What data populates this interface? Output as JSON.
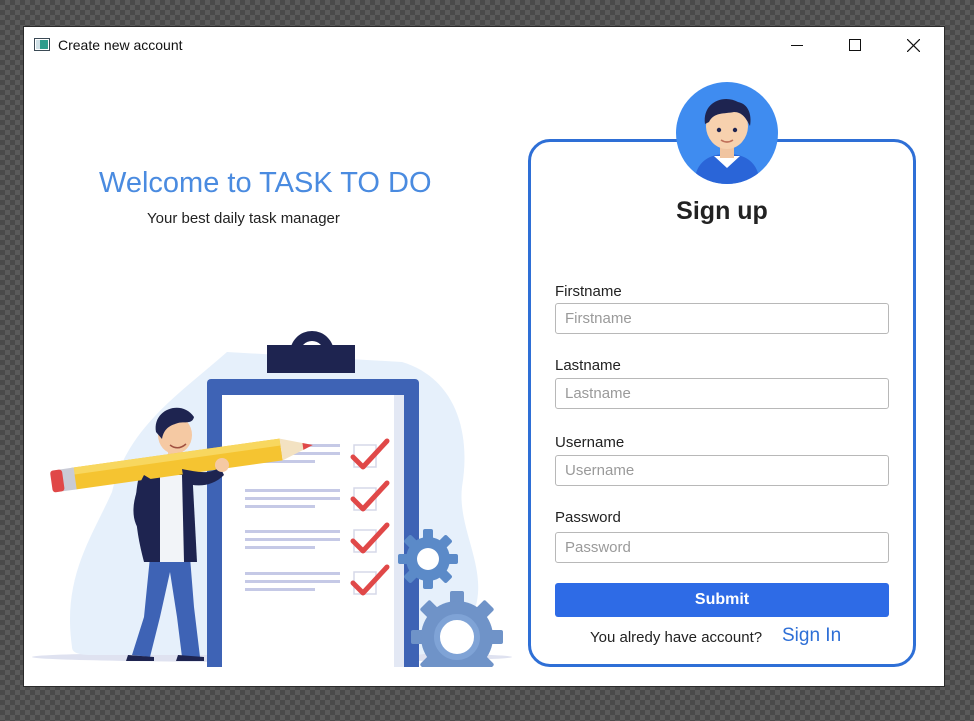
{
  "window": {
    "title": "Create new account",
    "controls": [
      "minimize-icon",
      "maximize-icon",
      "close-icon"
    ]
  },
  "hero": {
    "title": "Welcome to TASK TO DO",
    "subtitle": "Your best daily task manager",
    "illustration": "clipboard-checklist-illustration"
  },
  "form": {
    "title": "Sign up",
    "avatar_icon": "user-avatar-icon",
    "fields": [
      {
        "label": "Firstname",
        "placeholder": "Firstname",
        "value": ""
      },
      {
        "label": "Lastname",
        "placeholder": "Lastname",
        "value": ""
      },
      {
        "label": "Username",
        "placeholder": "Username",
        "value": ""
      },
      {
        "label": "Password",
        "placeholder": "Password",
        "value": ""
      }
    ],
    "submit_label": "Submit",
    "have_account_text": "You alredy have account?",
    "signin_label": "Sign In"
  },
  "colors": {
    "accent": "#2e6fd6",
    "button": "#2e6be6",
    "welcome_text": "#4a8be0",
    "illustration_navy": "#1e2450",
    "illustration_blue": "#3e63b5",
    "check_red": "#e04848",
    "pencil_yellow": "#f5c431"
  }
}
